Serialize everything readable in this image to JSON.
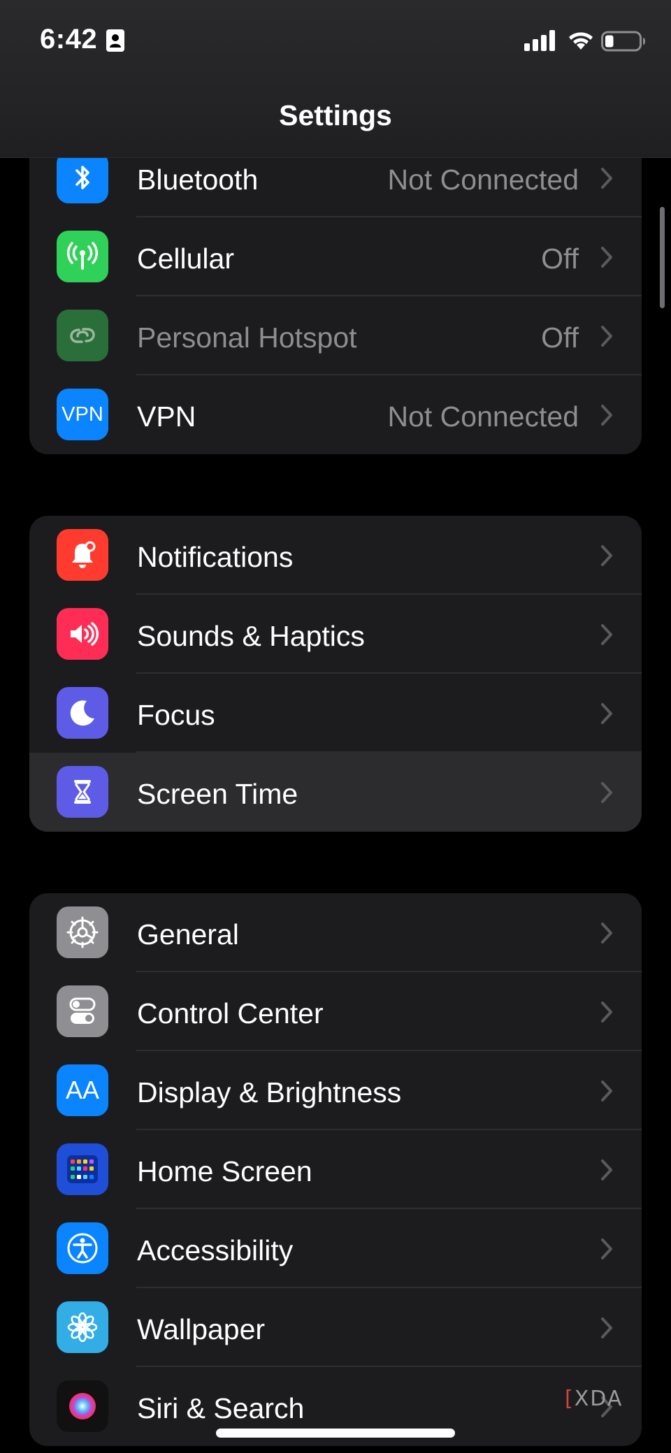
{
  "status_bar": {
    "time": "6:42",
    "icons": [
      "contact-card-icon",
      "signal-bars-icon",
      "wifi-icon",
      "battery-icon"
    ],
    "battery_level": 0.25
  },
  "header": {
    "title": "Settings"
  },
  "groups": [
    {
      "rows": [
        {
          "label": "Bluetooth",
          "value": "Not Connected",
          "icon": "bluetooth-icon",
          "color": "#0a84ff"
        },
        {
          "label": "Cellular",
          "value": "Off",
          "icon": "antenna-icon",
          "color": "#30d158"
        },
        {
          "label": "Personal Hotspot",
          "value": "Off",
          "icon": "hotspot-icon",
          "color": "#2a6e3a",
          "disabled": true
        },
        {
          "label": "VPN",
          "value": "Not Connected",
          "icon": "vpn-icon",
          "icon_text": "VPN",
          "color": "#0a84ff"
        }
      ]
    },
    {
      "rows": [
        {
          "label": "Notifications",
          "icon": "bell-icon",
          "color": "#ff3b30"
        },
        {
          "label": "Sounds & Haptics",
          "icon": "speaker-icon",
          "color": "#ff2d55"
        },
        {
          "label": "Focus",
          "icon": "moon-icon",
          "color": "#5e5ce6"
        },
        {
          "label": "Screen Time",
          "icon": "hourglass-icon",
          "color": "#5e5ce6",
          "highlighted": true
        }
      ]
    },
    {
      "rows": [
        {
          "label": "General",
          "icon": "gear-icon",
          "color": "#8e8e93"
        },
        {
          "label": "Control Center",
          "icon": "toggles-icon",
          "color": "#8e8e93"
        },
        {
          "label": "Display & Brightness",
          "icon": "text-size-icon",
          "icon_text": "AA",
          "color": "#0a84ff"
        },
        {
          "label": "Home Screen",
          "icon": "app-grid-icon",
          "color": "#1f4fd8"
        },
        {
          "label": "Accessibility",
          "icon": "accessibility-icon",
          "color": "#0a84ff"
        },
        {
          "label": "Wallpaper",
          "icon": "flower-icon",
          "color": "#32ade6"
        },
        {
          "label": "Siri & Search",
          "icon": "siri-icon",
          "color": "#1c1c1e"
        }
      ]
    }
  ],
  "watermark": {
    "text": "XDA"
  }
}
